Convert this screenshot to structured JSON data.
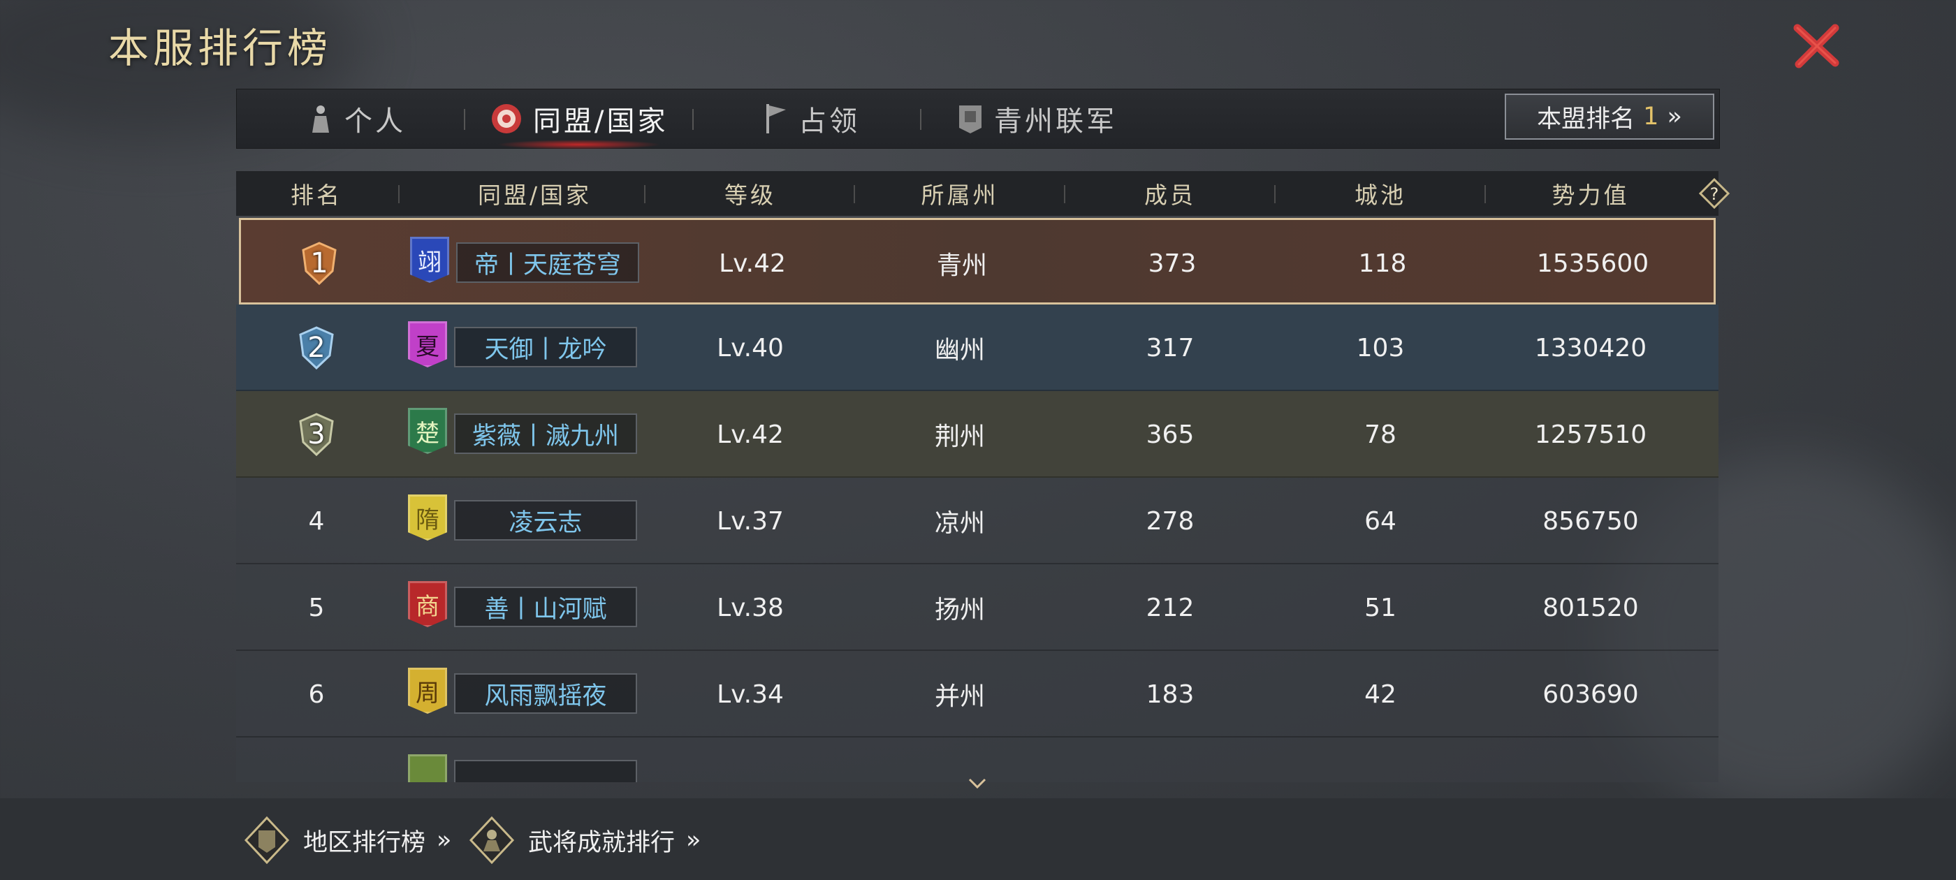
{
  "title": "本服排行榜",
  "tabs": [
    {
      "label": "个人",
      "icon": "person-icon"
    },
    {
      "label": "同盟/国家",
      "icon": "alliance-emblem-icon",
      "active": true
    },
    {
      "label": "占领",
      "icon": "flag-icon"
    },
    {
      "label": "青州联军",
      "icon": "army-banner-icon"
    }
  ],
  "my_rank": {
    "label": "本盟排名",
    "value": "1",
    "arrow": "»"
  },
  "columns": [
    "排名",
    "同盟/国家",
    "等级",
    "所属州",
    "成员",
    "城池",
    "势力值"
  ],
  "rows": [
    {
      "rank": "1",
      "flag_char": "翊",
      "flag_color": "#2a48b8",
      "name": "帝丨天庭苍穹",
      "level": "Lv.42",
      "state": "青州",
      "members": "373",
      "cities": "118",
      "power": "1535600"
    },
    {
      "rank": "2",
      "flag_char": "夏",
      "flag_color": "#c040c8",
      "name": "天御丨龙吟",
      "level": "Lv.40",
      "state": "幽州",
      "members": "317",
      "cities": "103",
      "power": "1330420"
    },
    {
      "rank": "3",
      "flag_char": "楚",
      "flag_color": "#2c7a4a",
      "name": "紫薇丨滅九州",
      "level": "Lv.42",
      "state": "荆州",
      "members": "365",
      "cities": "78",
      "power": "1257510"
    },
    {
      "rank": "4",
      "flag_char": "隋",
      "flag_color": "#d8c238",
      "name": "凌云志",
      "level": "Lv.37",
      "state": "凉州",
      "members": "278",
      "cities": "64",
      "power": "856750"
    },
    {
      "rank": "5",
      "flag_char": "商",
      "flag_color": "#b8282a",
      "name": "善丨山河赋",
      "level": "Lv.38",
      "state": "扬州",
      "members": "212",
      "cities": "51",
      "power": "801520"
    },
    {
      "rank": "6",
      "flag_char": "周",
      "flag_color": "#d4b030",
      "name": "风雨飘摇夜",
      "level": "Lv.34",
      "state": "并州",
      "members": "183",
      "cities": "42",
      "power": "603690"
    }
  ],
  "footer": [
    {
      "label": "地区排行榜",
      "arrow": "»",
      "icon": "region-ranking-icon"
    },
    {
      "label": "武将成就排行",
      "arrow": "»",
      "icon": "general-achievement-icon"
    }
  ],
  "colors": {
    "gold_text": "#e9d9a8",
    "name_blue": "#7fc6ec",
    "close_red": "#d23a3a",
    "row1_border": "#d9c29b"
  }
}
